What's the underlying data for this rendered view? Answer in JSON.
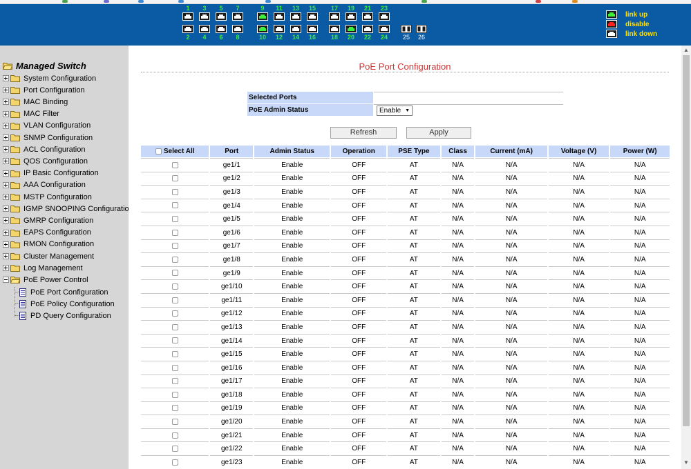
{
  "colors": {
    "banner": "#0b5aa4",
    "link_up": "#3cf03c",
    "disable": "#ff2020",
    "link_down": "#ffffff",
    "header_cell": "#c8d8f8",
    "title": "#cc3333",
    "legend_text": "#ffe000"
  },
  "banner": {
    "top_ports": [
      "1",
      "3",
      "5",
      "7",
      "9",
      "11",
      "13",
      "15",
      "17",
      "19",
      "21",
      "23"
    ],
    "bottom_ports": [
      "2",
      "4",
      "6",
      "8",
      "10",
      "12",
      "14",
      "16",
      "18",
      "20",
      "22",
      "24"
    ],
    "top_status": [
      "down",
      "down",
      "down",
      "down",
      "up",
      "down",
      "down",
      "down",
      "down",
      "down",
      "down",
      "down"
    ],
    "bottom_status": [
      "down",
      "down",
      "down",
      "down",
      "up",
      "down",
      "down",
      "down",
      "down",
      "up",
      "down",
      "down"
    ],
    "fiber_ports": [
      "25",
      "26"
    ],
    "legend": {
      "link_up": "link up",
      "disable": "disable",
      "link_down": "link down"
    }
  },
  "sidebar": {
    "title": "Managed Switch",
    "items": [
      {
        "label": "System Configuration",
        "expanded": false
      },
      {
        "label": "Port Configuration",
        "expanded": false
      },
      {
        "label": "MAC Binding",
        "expanded": false
      },
      {
        "label": "MAC Filter",
        "expanded": false
      },
      {
        "label": "VLAN Configuration",
        "expanded": false
      },
      {
        "label": "SNMP Configuration",
        "expanded": false
      },
      {
        "label": "ACL Configuration",
        "expanded": false
      },
      {
        "label": "QOS Configuration",
        "expanded": false
      },
      {
        "label": "IP Basic Configuration",
        "expanded": false
      },
      {
        "label": "AAA Configuration",
        "expanded": false
      },
      {
        "label": "MSTP Configuration",
        "expanded": false
      },
      {
        "label": "IGMP SNOOPING Configuration",
        "expanded": false
      },
      {
        "label": "GMRP Configuration",
        "expanded": false
      },
      {
        "label": "EAPS Configuration",
        "expanded": false
      },
      {
        "label": "RMON Configuration",
        "expanded": false
      },
      {
        "label": "Cluster Management",
        "expanded": false
      },
      {
        "label": "Log Management",
        "expanded": false
      },
      {
        "label": "PoE Power Control",
        "expanded": true
      }
    ],
    "poe_children": [
      "PoE Port Configuration",
      "PoE Policy Configuration",
      "PD Query Configuration"
    ]
  },
  "main": {
    "title": "PoE Port Configuration",
    "selected_ports_label": "Selected Ports",
    "selected_ports_value": "",
    "admin_status_label": "PoE Admin Status",
    "admin_status_value": "Enable",
    "refresh_label": "Refresh",
    "apply_label": "Apply",
    "table": {
      "select_all_label": "Select All",
      "headers": [
        "Port",
        "Admin Status",
        "Operation",
        "PSE Type",
        "Class",
        "Current (mA)",
        "Voltage (V)",
        "Power (W)"
      ],
      "rows": [
        [
          "ge1/1",
          "Enable",
          "OFF",
          "AT",
          "N/A",
          "N/A",
          "N/A",
          "N/A"
        ],
        [
          "ge1/2",
          "Enable",
          "OFF",
          "AT",
          "N/A",
          "N/A",
          "N/A",
          "N/A"
        ],
        [
          "ge1/3",
          "Enable",
          "OFF",
          "AT",
          "N/A",
          "N/A",
          "N/A",
          "N/A"
        ],
        [
          "ge1/4",
          "Enable",
          "OFF",
          "AT",
          "N/A",
          "N/A",
          "N/A",
          "N/A"
        ],
        [
          "ge1/5",
          "Enable",
          "OFF",
          "AT",
          "N/A",
          "N/A",
          "N/A",
          "N/A"
        ],
        [
          "ge1/6",
          "Enable",
          "OFF",
          "AT",
          "N/A",
          "N/A",
          "N/A",
          "N/A"
        ],
        [
          "ge1/7",
          "Enable",
          "OFF",
          "AT",
          "N/A",
          "N/A",
          "N/A",
          "N/A"
        ],
        [
          "ge1/8",
          "Enable",
          "OFF",
          "AT",
          "N/A",
          "N/A",
          "N/A",
          "N/A"
        ],
        [
          "ge1/9",
          "Enable",
          "OFF",
          "AT",
          "N/A",
          "N/A",
          "N/A",
          "N/A"
        ],
        [
          "ge1/10",
          "Enable",
          "OFF",
          "AT",
          "N/A",
          "N/A",
          "N/A",
          "N/A"
        ],
        [
          "ge1/11",
          "Enable",
          "OFF",
          "AT",
          "N/A",
          "N/A",
          "N/A",
          "N/A"
        ],
        [
          "ge1/12",
          "Enable",
          "OFF",
          "AT",
          "N/A",
          "N/A",
          "N/A",
          "N/A"
        ],
        [
          "ge1/13",
          "Enable",
          "OFF",
          "AT",
          "N/A",
          "N/A",
          "N/A",
          "N/A"
        ],
        [
          "ge1/14",
          "Enable",
          "OFF",
          "AT",
          "N/A",
          "N/A",
          "N/A",
          "N/A"
        ],
        [
          "ge1/15",
          "Enable",
          "OFF",
          "AT",
          "N/A",
          "N/A",
          "N/A",
          "N/A"
        ],
        [
          "ge1/16",
          "Enable",
          "OFF",
          "AT",
          "N/A",
          "N/A",
          "N/A",
          "N/A"
        ],
        [
          "ge1/17",
          "Enable",
          "OFF",
          "AT",
          "N/A",
          "N/A",
          "N/A",
          "N/A"
        ],
        [
          "ge1/18",
          "Enable",
          "OFF",
          "AT",
          "N/A",
          "N/A",
          "N/A",
          "N/A"
        ],
        [
          "ge1/19",
          "Enable",
          "OFF",
          "AT",
          "N/A",
          "N/A",
          "N/A",
          "N/A"
        ],
        [
          "ge1/20",
          "Enable",
          "OFF",
          "AT",
          "N/A",
          "N/A",
          "N/A",
          "N/A"
        ],
        [
          "ge1/21",
          "Enable",
          "OFF",
          "AT",
          "N/A",
          "N/A",
          "N/A",
          "N/A"
        ],
        [
          "ge1/22",
          "Enable",
          "OFF",
          "AT",
          "N/A",
          "N/A",
          "N/A",
          "N/A"
        ],
        [
          "ge1/23",
          "Enable",
          "OFF",
          "AT",
          "N/A",
          "N/A",
          "N/A",
          "N/A"
        ]
      ]
    }
  }
}
